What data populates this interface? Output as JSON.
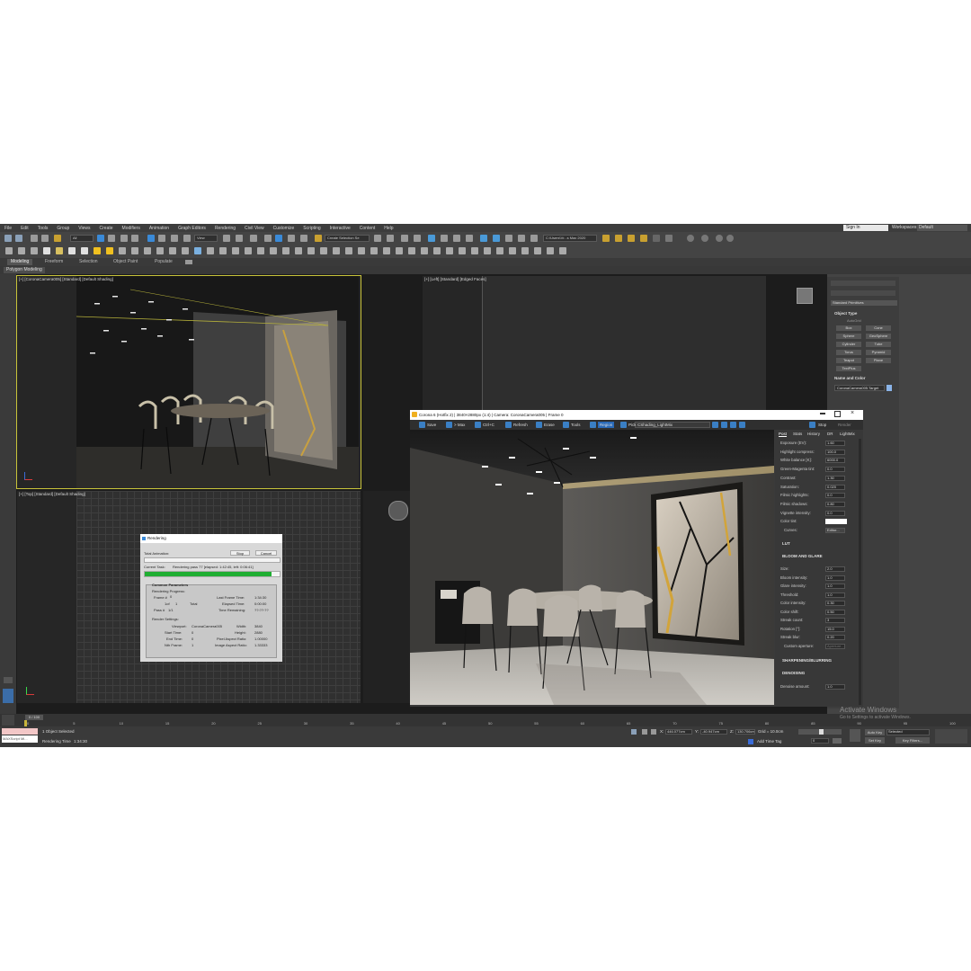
{
  "menu": [
    "File",
    "Edit",
    "Tools",
    "Group",
    "Views",
    "Create",
    "Modifiers",
    "Animation",
    "Graph Editors",
    "Rendering",
    "Civil View",
    "Customize",
    "Scripting",
    "Interactive",
    "Content",
    "Help"
  ],
  "header": {
    "sign_in": "Sign In",
    "workspaces_label": "Workspaces:",
    "workspace_value": "Default"
  },
  "toolbar": {
    "all_filter": "All",
    "view_dropdown": "View",
    "create_selection_set": "Create Selection Se",
    "project_path": "C:\\Users\\Vr...s Max 2020"
  },
  "ribbon": {
    "tabs": [
      "Modeling",
      "Freeform",
      "Selection",
      "Object Paint",
      "Populate"
    ],
    "active_tab": "Modeling",
    "sub_tab": "Polygon Modeling"
  },
  "viewports": {
    "perspective_label": "[+] [CoronaCamera005] [Standard] [Default Shading]",
    "left_label": "[+] [Left] [Standard] [Edged Faces]",
    "top_label": "[+] [Top] [Standard] [Default Shading]"
  },
  "command_panel": {
    "dropdown": "Standard Primitives",
    "object_type_head": "Object Type",
    "autogrid": "AutoGrid",
    "buttons": [
      "Box",
      "Cone",
      "Sphere",
      "GeoSphere",
      "Cylinder",
      "Tube",
      "Torus",
      "Pyramid",
      "Teapot",
      "Plane",
      "TextPlus"
    ],
    "name_color_head": "Name and Color",
    "object_name": "CoronaCamera005.Target"
  },
  "rendering_dialog": {
    "title": "Rendering",
    "stop": "Stop",
    "cancel": "Cancel",
    "total_animation": "Total Animation:",
    "current_task_label": "Current Task:",
    "current_task": "Rendering pass 77 [elapsed: 1:42:45, left: 0:06:41]",
    "task_progress": 0.94,
    "common_parameters": "Common Parameters",
    "rendering_progress": "Rendering Progress:",
    "frame_label": "Frame #",
    "frame_value": "0",
    "of_label": "1of",
    "of_value": "1",
    "total": "Total",
    "pass_label": "Pass #",
    "pass_value": "1/1",
    "last_frame_time_label": "Last Frame Time:",
    "last_frame_time": "1:34:30",
    "elapsed_time_label": "Elapsed Time:",
    "elapsed_time": "0:00:00",
    "time_remaining_label": "Time Remaining:",
    "time_remaining": "??:??:??",
    "render_settings": "Render Settings:",
    "viewport_label": "Viewport:",
    "viewport": "CoronaCamera005",
    "width_label": "Width:",
    "width": "3840",
    "start_time_label": "Start Time:",
    "start_time": "0",
    "height_label": "Height:",
    "height": "2880",
    "end_time_label": "End Time:",
    "end_time": "0",
    "pixel_aspect_label": "Pixel Aspect Ratio:",
    "pixel_aspect": "1.00000",
    "nth_frame_label": "Nth Frame:",
    "nth_frame": "1",
    "image_aspect_label": "Image Aspect Ratio:",
    "image_aspect": "1.33333"
  },
  "vfb": {
    "title": "Corona 6 (Hotfix 2) | 3840×2880px (1:4) | Camera: CoronaCamera005 | Frame 0",
    "tools": [
      "Save",
      "> Max",
      "Ctrl+C",
      "Refresh",
      "Erase",
      "Tools",
      "Region",
      "Pick"
    ],
    "active_tool": "Region",
    "lightmix_select": "CShading_LightMix",
    "stop": "Stop",
    "render": "Render",
    "tabs": [
      "Post",
      "Stats",
      "History",
      "DR",
      "LightMix"
    ],
    "active_tab": "Post",
    "tone": [
      {
        "label": "Exposure (EV):",
        "value": "1.60"
      },
      {
        "label": "Highlight compress:",
        "value": "100.0"
      },
      {
        "label": "White balance [K]:",
        "value": "6000.0"
      },
      {
        "label": "Green-Magenta tint:",
        "value": "0.0"
      },
      {
        "label": "Contrast:",
        "value": "1.30"
      },
      {
        "label": "Saturation:",
        "value": "0.020"
      },
      {
        "label": "Filmic highlights:",
        "value": "0.0"
      },
      {
        "label": "Filmic shadows:",
        "value": "0.80"
      },
      {
        "label": "Vignette intensity:",
        "value": "0.0"
      }
    ],
    "color_tint": "Color tint:",
    "curves": "Curves:",
    "curves_editor": "Editor...",
    "lut": "LUT",
    "bloom_head": "BLOOM AND GLARE",
    "bloom": [
      {
        "label": "Size:",
        "value": "2.0"
      },
      {
        "label": "Bloom intensity:",
        "value": "1.0"
      },
      {
        "label": "Glare intensity:",
        "value": "1.0"
      },
      {
        "label": "Threshold:",
        "value": "1.0"
      },
      {
        "label": "Color intensity:",
        "value": "0.30"
      },
      {
        "label": "Color shift:",
        "value": "0.50"
      },
      {
        "label": "Streak count:",
        "value": "3"
      },
      {
        "label": "Rotation [°]:",
        "value": "15.0"
      },
      {
        "label": "Streak blur:",
        "value": "0.20"
      }
    ],
    "custom_aperture": "Custom aperture:",
    "custom_aperture_btn": "Aperture...",
    "sharpening": "SHARPENING/BLURRING",
    "denoising": "DENOISING",
    "denoise_label": "Denoise amount:",
    "denoise_value": "1.0"
  },
  "timeline": {
    "frame_indicator": "0 / 100",
    "ticks": [
      "0",
      "5",
      "10",
      "15",
      "20",
      "25",
      "30",
      "35",
      "40",
      "45",
      "50",
      "55",
      "60",
      "65",
      "70",
      "75",
      "80",
      "85",
      "90",
      "95",
      "100"
    ]
  },
  "status": {
    "maxscript": "MAXScript Mi...",
    "selected": "1 Object Selected",
    "rendering_time_label": "Rendering Time",
    "rendering_time": "1:34:30",
    "x_label": "X:",
    "x": "446.077cm",
    "y_label": "Y:",
    "y": "-40.947cm",
    "z_label": "Z:",
    "z": "130.706cm",
    "grid": "Grid = 10.0cm",
    "add_time_tag": "Add Time Tag",
    "frame_field": "0",
    "auto_key": "Auto Key",
    "selected_dropdown": "Selected",
    "set_key": "Set Key",
    "key_filters": "Key Filters..."
  },
  "watermark": {
    "line1": "Activate Windows",
    "line2": "Go to Settings to activate Windows."
  }
}
